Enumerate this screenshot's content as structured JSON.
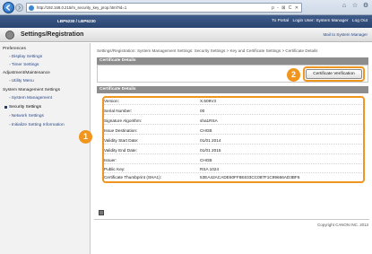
{
  "browser": {
    "url": "http://192.168.0.215/m_security_key_prop.html?id=1",
    "addr_tools": "ρ - ⊠ C ✕",
    "window_icons": [
      "⌂",
      "☆",
      "⚙"
    ]
  },
  "device": {
    "name": "LBP6230 / LBP6230",
    "links": [
      "To Portal",
      "Login User: System Manager",
      "Log Out"
    ]
  },
  "header": {
    "title": "Settings/Registration",
    "mail_link": "Mail to System Manager"
  },
  "sidebar": {
    "preferences": "Preferences",
    "display_settings": "Display Settings",
    "timer_settings": "Timer Settings",
    "adjustment": "Adjustment/Maintenance",
    "utility_menu": "Utility Menu",
    "sys_mgmt": "System Management Settings",
    "system_management": "System Management",
    "security_settings": "Security Settings",
    "network_settings": "Network Settings",
    "initialize": "Initialize Setting Information"
  },
  "breadcrumb": "Settings/Registration: System Management Settings: Security Settings > Key and Certificate Settings > Certificate Details",
  "panel": {
    "head1": "Certificate Details",
    "verify_button": "Certificate Verification",
    "head2": "Certificate Details"
  },
  "details": [
    {
      "key": "Version:",
      "value": "X.509V3"
    },
    {
      "key": "Serial Number:",
      "value": "00"
    },
    {
      "key": "Signature Algorithm:",
      "value": "sha1RSA"
    },
    {
      "key": "Issue Destination:",
      "value": "CHGB"
    },
    {
      "key": "Validity Start Date:",
      "value": "01/01 2014"
    },
    {
      "key": "Validity End Date:",
      "value": "01/01 2015"
    },
    {
      "key": "Issuer:",
      "value": "CHGB"
    },
    {
      "key": "Public Key:",
      "value": "RSA 1024"
    },
    {
      "key": "Certificate Thumbprint (SHA1):",
      "value": "53EA42ACADE60FF8E633CC087F1C99666AD3BF6"
    }
  ],
  "callouts": {
    "one": "1",
    "two": "2"
  },
  "footer": {
    "copyright": "Copyright CANON INC. 2013"
  }
}
